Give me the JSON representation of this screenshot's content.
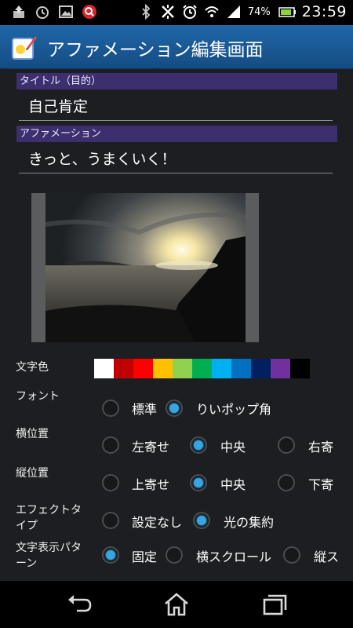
{
  "status_bar": {
    "icons_left": [
      "upload-icon",
      "alarm-icon",
      "image-icon",
      "search-icon"
    ],
    "icons_right": [
      "bluetooth-icon",
      "sync-off-icon",
      "alarm-clock-icon",
      "wifi-icon",
      "signal-icon"
    ],
    "battery": "74%",
    "time": "23:59"
  },
  "action_bar": {
    "title": "アファメーション編集画面"
  },
  "sections": {
    "title_header": "タイトル（目的）",
    "title_value": "自己肯定",
    "affirmation_header": "アファメーション",
    "affirmation_value": "きっと、うまくいく！"
  },
  "text_color": {
    "label": "文字色",
    "colors": [
      "#ffffff",
      "#c00000",
      "#ff0000",
      "#ffc000",
      "#92d050",
      "#00b050",
      "#00b0f0",
      "#0070c0",
      "#002060",
      "#7030a0",
      "#000000"
    ]
  },
  "font": {
    "label": "フォント",
    "options": [
      "標準",
      "りいポップ角"
    ],
    "selected": 1
  },
  "h_position": {
    "label": "横位置",
    "options": [
      "左寄せ",
      "中央",
      "右寄"
    ],
    "selected": 1
  },
  "v_position": {
    "label": "縦位置",
    "options": [
      "上寄せ",
      "中央",
      "下寄"
    ],
    "selected": 1
  },
  "effect": {
    "label_line1": "エフェクトタ",
    "label_line2": "イプ",
    "options": [
      "設定なし",
      "光の集約"
    ],
    "selected": 1
  },
  "display_pattern": {
    "label_line1": "文字表示パタ",
    "label_line2": "ーン",
    "options": [
      "固定",
      "横スクロール",
      "縦ス"
    ],
    "selected": 0
  },
  "nav": {
    "buttons": [
      "back",
      "home",
      "recent-apps"
    ]
  }
}
